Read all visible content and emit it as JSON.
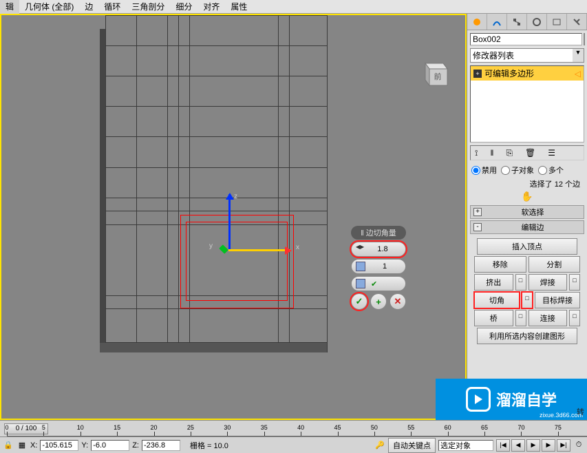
{
  "top_menu": [
    "辑",
    "几何体 (全部)",
    "边",
    "循环",
    "三角剖分",
    "细分",
    "对齐",
    "属性"
  ],
  "view_cube_label": "前",
  "caddy": {
    "title": "‖ 边切角量",
    "value": "1.8",
    "segments": "1",
    "ok": "✓",
    "plus": "+",
    "cancel": "✕"
  },
  "cmd": {
    "object_name": "Box002",
    "modifier_list": "修改器列表",
    "stack_item": "可编辑多边形",
    "sub_radio": {
      "disable": "禁用",
      "sub": "子对象",
      "multi": "多个"
    },
    "selected_info": "选择了 12 个边",
    "rollouts": {
      "soft_sel": "软选择",
      "edit_edges": "编辑边"
    },
    "buttons": {
      "insert_vertex": "插入顶点",
      "remove": "移除",
      "split": "分割",
      "extrude": "挤出",
      "weld": "焊接",
      "chamfer": "切角",
      "target_weld": "目标焊接",
      "bridge": "桥",
      "connect": "连接",
      "create_shape": "利用所选内容创建图形",
      "rotate": "转"
    }
  },
  "timeline": {
    "current": "0 / 100",
    "ticks": [
      0,
      5,
      10,
      15,
      20,
      25,
      30,
      35,
      40,
      45,
      50,
      55,
      60,
      65,
      70,
      75
    ]
  },
  "status": {
    "x_label": "X:",
    "x": "-105.615",
    "y_label": "Y:",
    "y": "-6.0",
    "z_label": "Z:",
    "z": "-236.8",
    "grid_label": "栅格 = 10.0",
    "auto_key": "自动关键点",
    "selected_obj": "选定对象"
  },
  "watermark": {
    "text": "溜溜自学",
    "url": "zixue.3d66.com"
  }
}
